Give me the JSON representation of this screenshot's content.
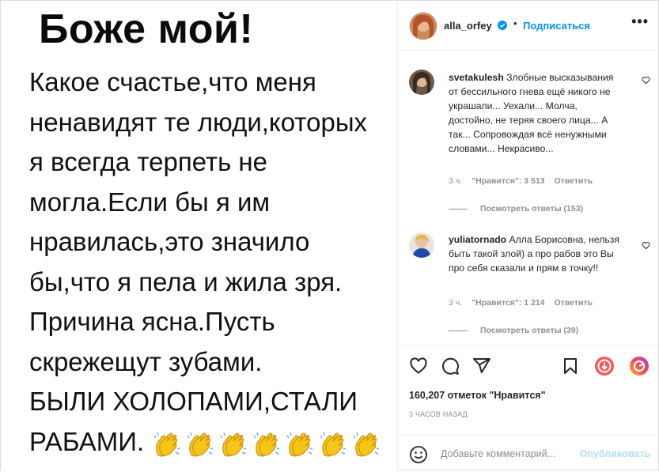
{
  "post": {
    "title": "Боже мой!",
    "lines": [
      "Какое счастье,что меня",
      "ненавидят те люди,которых",
      "я всегда терпеть не",
      "могла.Если бы я им",
      "нравилась,это значило",
      "бы,что я пела и жила зря.",
      "Причина ясна.Пусть",
      "скрежещут зубами.",
      "БЫЛИ ХОЛОПАМИ,СТАЛИ",
      "РАБАМИ."
    ],
    "clap_count": 7
  },
  "header": {
    "username": "alla_orfey",
    "separator": "•",
    "follow_label": "Подписаться",
    "more_label": "•••"
  },
  "comments": [
    {
      "username": "svetakulesh",
      "text": "Злобные высказывания от бессильного гнева ещё никого не украшали... Уехали... Молча, достойно, не теряя своего лица... А так... Сопровождая всё ненужными словами... Некрасиво...",
      "ago": "3 ч.",
      "likes": "\"Нравится\": 3 513",
      "reply_label": "Ответить",
      "view_replies": "Посмотреть ответы (153)"
    },
    {
      "username": "yuliatornado",
      "text": "Алла Борисовна, нельзя быть такой злой) а про рабов это Вы про себя сказали и прям в точку!!",
      "ago": "3 ч.",
      "likes": "\"Нравится\": 1 214",
      "reply_label": "Ответить",
      "view_replies": "Посмотреть ответы (39)"
    }
  ],
  "actions": {
    "icons": [
      "heart-icon",
      "comment-icon",
      "share-icon",
      "bookmark-icon",
      "download-icon",
      "reels-icon"
    ],
    "likes_text": "160,207 отметок \"Нравится\"",
    "time_text": "3 ЧАСОВ НАЗАД"
  },
  "add_comment": {
    "placeholder": "Добавьте комментарий...",
    "publish_label": "Опубликовать"
  },
  "colors": {
    "link_blue": "#0095f6",
    "muted": "#8e8e8e",
    "publish_disabled": "#b2dffc",
    "text": "#262626",
    "clap_yellow": "#f5c518"
  }
}
